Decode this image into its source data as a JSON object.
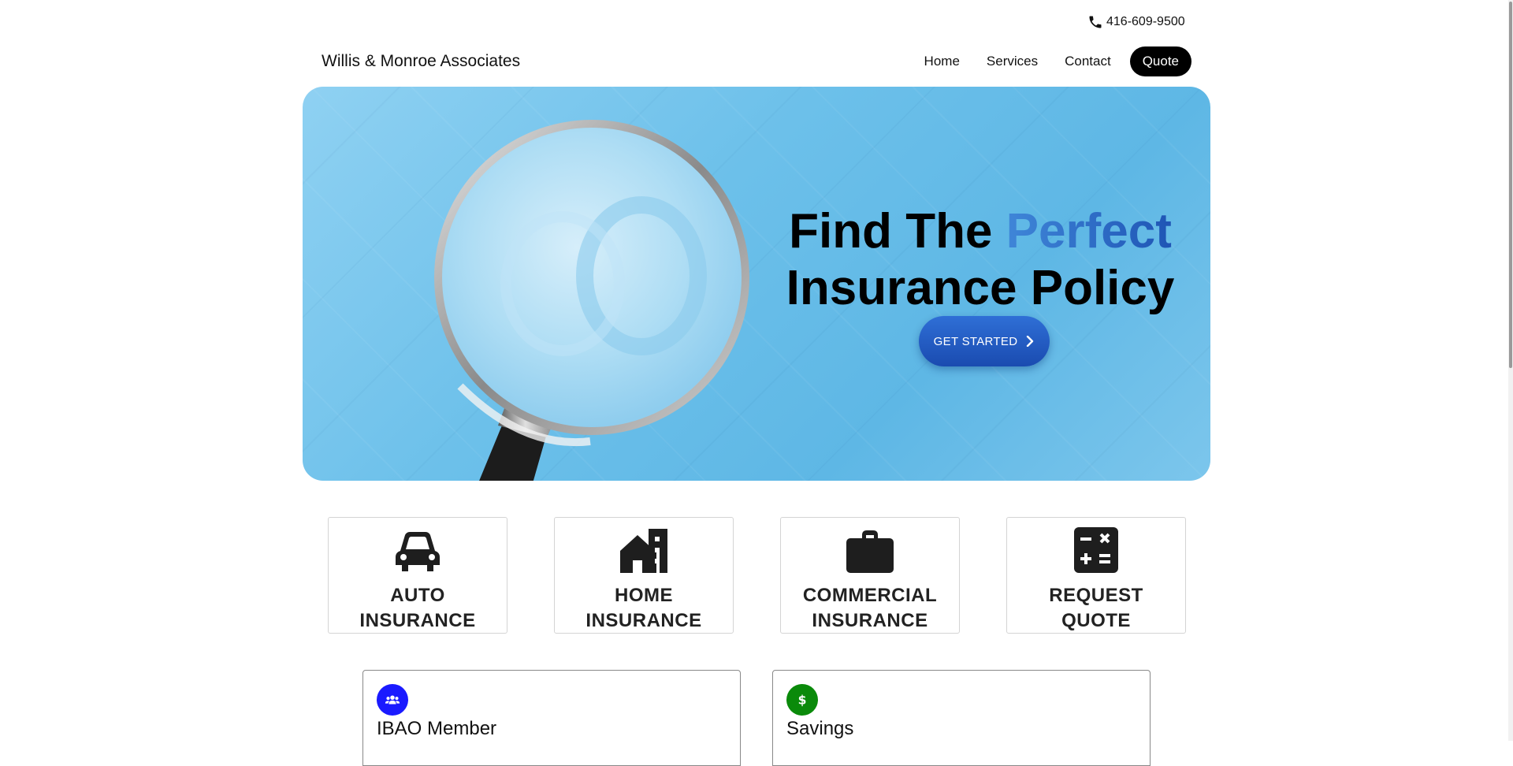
{
  "topbar": {
    "phone": "416-609-9500",
    "phone_icon": "phone-icon"
  },
  "header": {
    "brand": "Willis & Monroe Associates",
    "nav": [
      "Home",
      "Services",
      "Contact",
      "Quote"
    ]
  },
  "hero": {
    "title_line1_a": "Find The ",
    "title_line1_b": "Perfect",
    "title_line2": "Insurance Policy",
    "cta_label": "GET STARTED",
    "accent_color": "#2a63c4"
  },
  "services": [
    {
      "line1": "AUTO",
      "line2": "INSURANCE",
      "icon": "car-icon"
    },
    {
      "line1": "HOME",
      "line2": "INSURANCE",
      "icon": "house-icon"
    },
    {
      "line1": "COMMERCIAL",
      "line2": "INSURANCE",
      "icon": "briefcase-icon"
    },
    {
      "line1": "REQUEST",
      "line2": "QUOTE",
      "icon": "calculator-icon"
    }
  ],
  "features": [
    {
      "title": "IBAO Member",
      "icon": "group-icon",
      "color": "#1a1aff"
    },
    {
      "title": "Savings",
      "icon": "dollar-icon",
      "color": "#0a8a0a"
    }
  ]
}
